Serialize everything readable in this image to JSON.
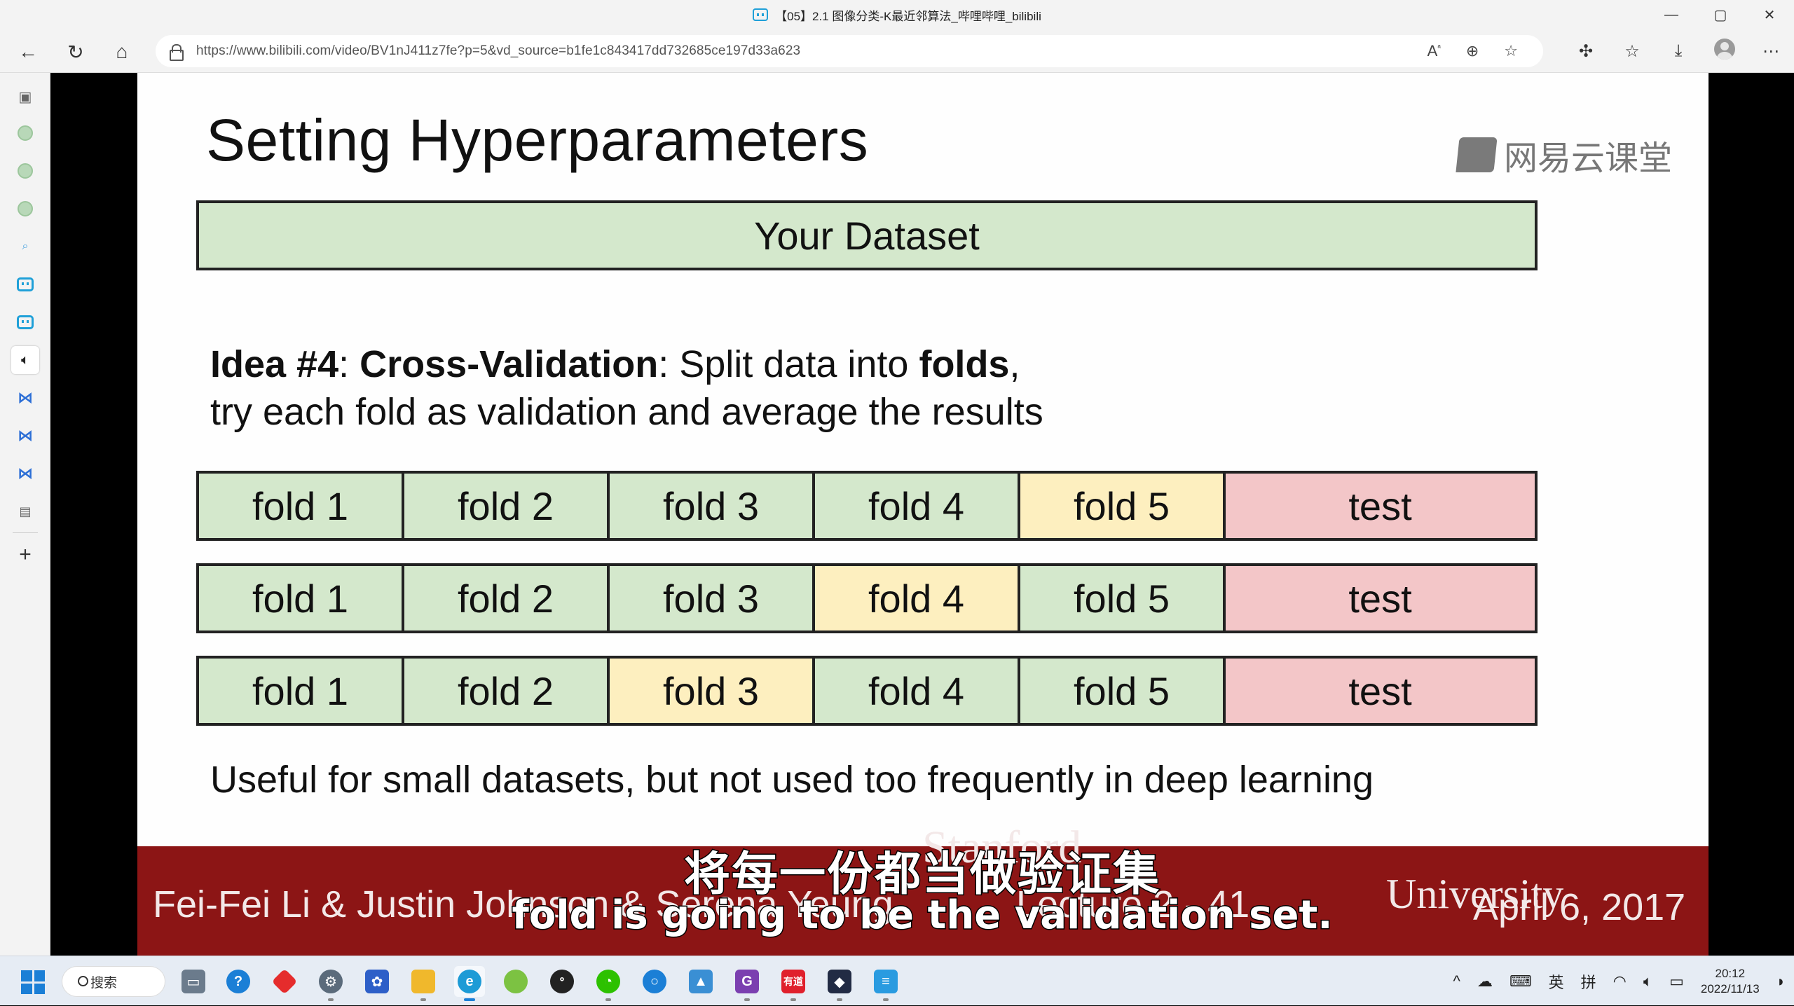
{
  "window": {
    "title": "【05】2.1 图像分类-K最近邻算法_哔哩哔哩_bilibili",
    "minimize": "—",
    "maximize": "▢",
    "close": "✕"
  },
  "browser": {
    "url_host": "https://www.bilibili.com",
    "url_path": "/video/BV1nJ411z7fe?p=5&vd_source=b1fe1c843417dd732685ce197d33a623",
    "nav": {
      "back": "←",
      "refresh": "↻",
      "home": "⌂"
    },
    "url_icons": [
      "read-aloud-icon",
      "zoom-icon",
      "add-favorite-icon"
    ],
    "toolbar_icons": [
      "extensions-icon",
      "favorites-icon",
      "downloads-icon",
      "profile-avatar",
      "more-icon"
    ]
  },
  "sidebar": {
    "items": [
      "tabs-icon",
      "avatar-1",
      "avatar-2",
      "avatar-3",
      "search-icon",
      "bilibili-tab-1",
      "bilibili-tab-2",
      "audio-playing-tab",
      "bow-tab-1",
      "bow-tab-2",
      "bow-tab-3",
      "calendar-tab",
      "add-tab"
    ]
  },
  "slide": {
    "title": "Setting Hyperparameters",
    "logo_text": "网易云课堂",
    "dataset_label": "Your Dataset",
    "idea_label": "Idea #4",
    "idea_method": "Cross-Validation",
    "idea_text1": ": Split data into ",
    "idea_folds": "folds",
    "idea_text2": ",",
    "idea_line2": "try each fold as validation and average the results",
    "rows": [
      {
        "cells": [
          "fold 1",
          "fold 2",
          "fold 3",
          "fold 4",
          "fold 5",
          "test"
        ],
        "validation_index": 4
      },
      {
        "cells": [
          "fold 1",
          "fold 2",
          "fold 3",
          "fold 4",
          "fold 5",
          "test"
        ],
        "validation_index": 3
      },
      {
        "cells": [
          "fold 1",
          "fold 2",
          "fold 3",
          "fold 4",
          "fold 5",
          "test"
        ],
        "validation_index": 2
      }
    ],
    "colors": {
      "train": "#d4e8cc",
      "validation": "#fdefbf",
      "test": "#f3c6c8",
      "footer": "#8c1515"
    },
    "note": "Useful for small datasets, but not used too frequently in deep learning",
    "footer_authors": "Fei-Fei Li & Justin Johnson & Serena Yeung",
    "footer_lecture": "Lecture 2 -  41",
    "footer_stanford": "Stanford",
    "footer_university": "University",
    "footer_date": "April 6, 2017"
  },
  "subtitles": {
    "chinese": "将每一份都当做验证集",
    "english": "fold is going to be the validation set."
  },
  "taskbar": {
    "search_label": "搜索",
    "apps": [
      "task-view",
      "help",
      "app-red-diamond",
      "settings",
      "photos-app",
      "file-explorer",
      "edge",
      "chrome-like",
      "qq",
      "wechat",
      "search-app",
      "image-viewer",
      "pdf-app",
      "youdao",
      "game-app",
      "notepad"
    ],
    "youdao_label": "有道",
    "tray_lang": "英",
    "tray_ime": "拼",
    "time": "20:12",
    "date": "2022/11/13"
  }
}
